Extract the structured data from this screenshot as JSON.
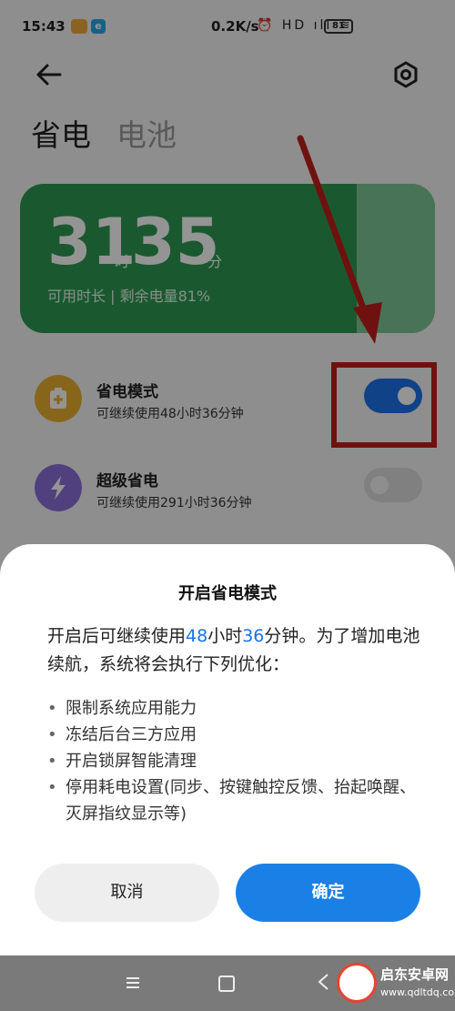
{
  "status_bar": {
    "time": "15:43",
    "net_speed": "0.2K/s",
    "icons": "⏰ HD ıll ≋",
    "battery": "81"
  },
  "header": {
    "tabs": [
      "省电",
      "电池"
    ]
  },
  "battery_card": {
    "hours": "31",
    "hours_unit": "时",
    "minutes": "35",
    "minutes_unit": "分",
    "info": "可用时长 | 剩余电量81%",
    "level_fraction": 0.81
  },
  "modes": [
    {
      "title": "省电模式",
      "subtitle": "可继续使用48小时36分钟",
      "enabled": true
    },
    {
      "title": "超级省电",
      "subtitle": "可继续使用291小时36分钟",
      "enabled": false
    }
  ],
  "dialog": {
    "title": "开启省电模式",
    "body_prefix": "开启后可继续使用",
    "hours_value": "48",
    "hours_word": "小时",
    "minutes_value": "36",
    "body_suffix": "分钟。为了增加电池续航，系统将会执行下列优化：",
    "items": [
      "限制系统应用能力",
      "冻结后台三方应用",
      "开启锁屏智能清理",
      "停用耗电设置(同步、按键触控反馈、抬起唤醒、灭屏指纹显示等)"
    ],
    "cancel_label": "取消",
    "confirm_label": "确定"
  },
  "watermark": {
    "name": "启东安卓网",
    "url": "www.qdltdq.com"
  },
  "colors": {
    "accent": "#1a80e6",
    "card_green": "#2e9a52",
    "annotation_red": "#c0201a"
  }
}
